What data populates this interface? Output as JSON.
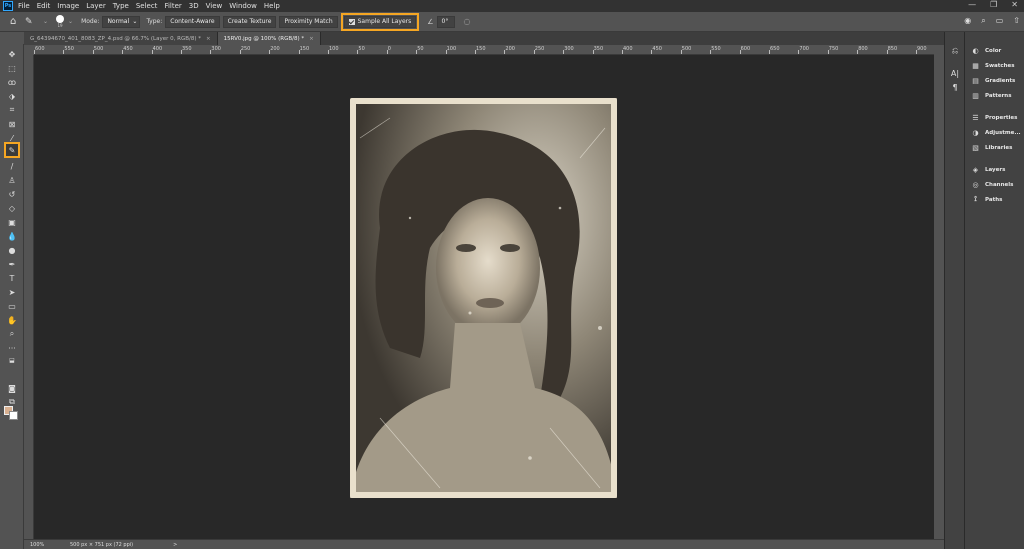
{
  "menu": {
    "logo": "Ps",
    "items": [
      "File",
      "Edit",
      "Image",
      "Layer",
      "Type",
      "Select",
      "Filter",
      "3D",
      "View",
      "Window",
      "Help"
    ],
    "window_controls": [
      "—",
      "❐",
      "✕"
    ]
  },
  "options": {
    "brush_size": "19",
    "mode_label": "Mode:",
    "mode_value": "Normal",
    "type_label": "Type:",
    "type_buttons": [
      "Content-Aware",
      "Create Texture",
      "Proximity Match"
    ],
    "sample_all_layers": "Sample All Layers",
    "angle_value": "0°"
  },
  "tabs": [
    {
      "label": "G_64394670_401_8083_ZP_4.psd @ 66.7% (Layer 0, RGB/8) *",
      "active": false
    },
    {
      "label": "15RV0.jpg @ 100% (RGB/8) *",
      "active": true
    }
  ],
  "ruler": {
    "labels": [
      "600",
      "550",
      "500",
      "450",
      "400",
      "350",
      "300",
      "250",
      "200",
      "150",
      "100",
      "50",
      "0",
      "50",
      "100",
      "150",
      "200",
      "250",
      "300",
      "350",
      "400",
      "450",
      "500",
      "550",
      "600",
      "650",
      "700",
      "750",
      "800",
      "850",
      "900",
      "950",
      "1000",
      "1050"
    ]
  },
  "status": {
    "zoom": "100%",
    "dimensions": "500 px × 751 px (72 ppi)",
    "arrow": ">"
  },
  "panels": {
    "group1": [
      {
        "icon": "◐",
        "label": "Color"
      },
      {
        "icon": "▦",
        "label": "Swatches"
      },
      {
        "icon": "▤",
        "label": "Gradients"
      },
      {
        "icon": "▥",
        "label": "Patterns"
      }
    ],
    "group2": [
      {
        "icon": "☰",
        "label": "Properties"
      },
      {
        "icon": "◑",
        "label": "Adjustme..."
      },
      {
        "icon": "▧",
        "label": "Libraries"
      }
    ],
    "group3": [
      {
        "icon": "◈",
        "label": "Layers"
      },
      {
        "icon": "◎",
        "label": "Channels"
      },
      {
        "icon": "⟟",
        "label": "Paths"
      }
    ]
  },
  "icons": {
    "home": "⌂",
    "healing_brush": "✎",
    "search": "⌕",
    "share": "⇧"
  },
  "colors": {
    "accent_highlight": "#f5a623",
    "foreground_swatch": "#d9b090",
    "background_swatch": "#ffffff"
  }
}
